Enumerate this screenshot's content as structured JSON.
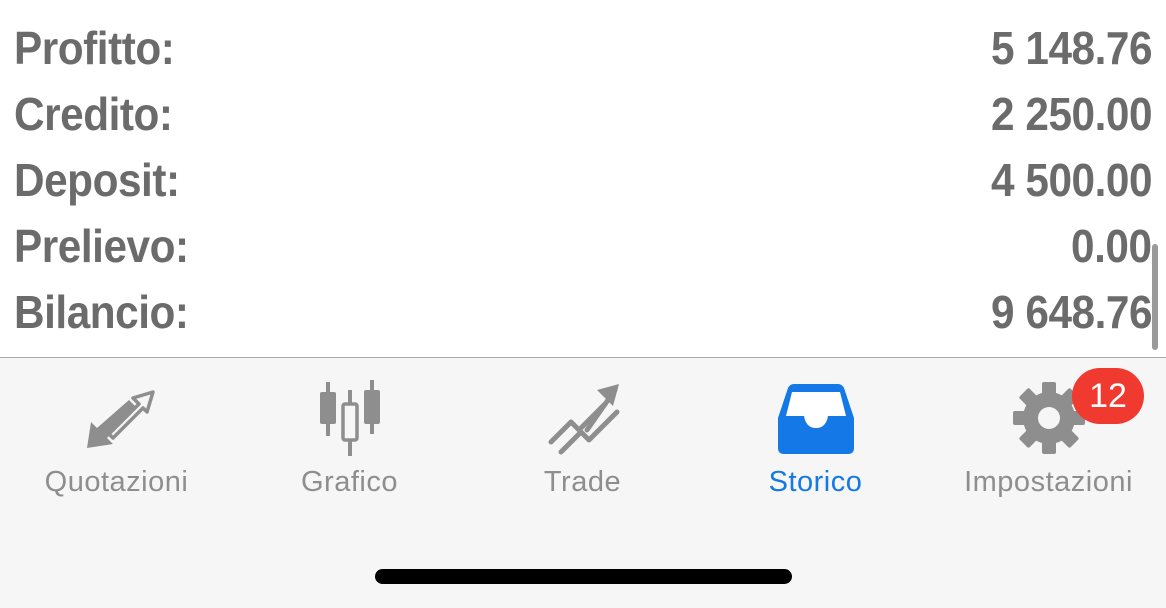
{
  "summary": {
    "rows": [
      {
        "label": "Profitto:",
        "value": "5 148.76"
      },
      {
        "label": "Credito:",
        "value": "2 250.00"
      },
      {
        "label": "Deposit:",
        "value": "4 500.00"
      },
      {
        "label": "Prelievo:",
        "value": "0.00"
      },
      {
        "label": "Bilancio:",
        "value": "9 648.76"
      }
    ]
  },
  "tabbar": {
    "tabs": [
      {
        "label": "Quotazioni",
        "icon": "quotes-arrows-icon",
        "active": false
      },
      {
        "label": "Grafico",
        "icon": "candlestick-chart-icon",
        "active": false
      },
      {
        "label": "Trade",
        "icon": "trade-trend-icon",
        "active": false
      },
      {
        "label": "Storico",
        "icon": "inbox-tray-icon",
        "active": true
      },
      {
        "label": "Impostazioni",
        "icon": "gear-icon",
        "active": false
      }
    ],
    "settings_badge": "12"
  },
  "colors": {
    "text_gray": "#6b6b6b",
    "inactive_tab": "#8e8e8e",
    "active_tab": "#1479e6",
    "badge": "#f03a30",
    "tabbar_bg": "#f6f6f6"
  }
}
